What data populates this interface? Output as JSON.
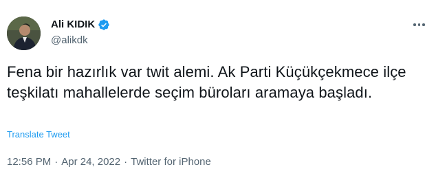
{
  "author": {
    "display_name": "Ali KIDIK",
    "handle": "@alikdk",
    "verified": true
  },
  "tweet": {
    "text": "Fena bir hazırlık var twit alemi. Ak Parti Küçükçekmece ilçe teşkilatı mahallelerde seçim büroları aramaya başladı.",
    "translate_label": "Translate Tweet"
  },
  "meta": {
    "time": "12:56 PM",
    "separator": "·",
    "date": "Apr 24, 2022",
    "source": "Twitter for iPhone"
  },
  "colors": {
    "accent": "#1d9bf0",
    "text": "#0f1419",
    "secondary": "#536471"
  },
  "icons": {
    "verified": "verified-badge-icon",
    "more": "more-options-icon"
  }
}
